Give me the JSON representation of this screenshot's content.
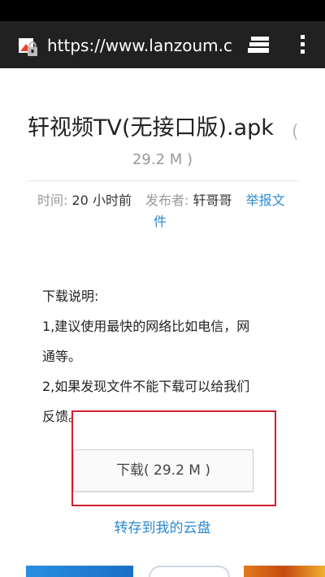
{
  "browser": {
    "url": "https://www.lanzoum.com",
    "site_icon": "lock-page-icon",
    "tabs_icon": "tabs-icon",
    "menu_icon": "overflow-menu-icon"
  },
  "file": {
    "title": "轩视频TV(无接口版).apk",
    "title_paren_open": "(",
    "size": "29.2 M )"
  },
  "meta": {
    "time_label": "时间:",
    "time_value": "20 小时前",
    "publisher_label": "发布者:",
    "publisher_value": "轩哥哥",
    "report_line1": "举报文",
    "report_line2": "件"
  },
  "description": {
    "heading": "下载说明:",
    "line1": "1,建议使用最快的网络比如电信，网",
    "line2": "通等。",
    "line3": "2,如果发现文件不能下载可以给我们",
    "line4": "反馈。"
  },
  "actions": {
    "download_label": "下载( 29.2 M )",
    "save_to_cloud": "转存到我的云盘"
  },
  "colors": {
    "link": "#2b8ad6",
    "toolbar": "#212121",
    "highlight_box": "#d2202f"
  }
}
